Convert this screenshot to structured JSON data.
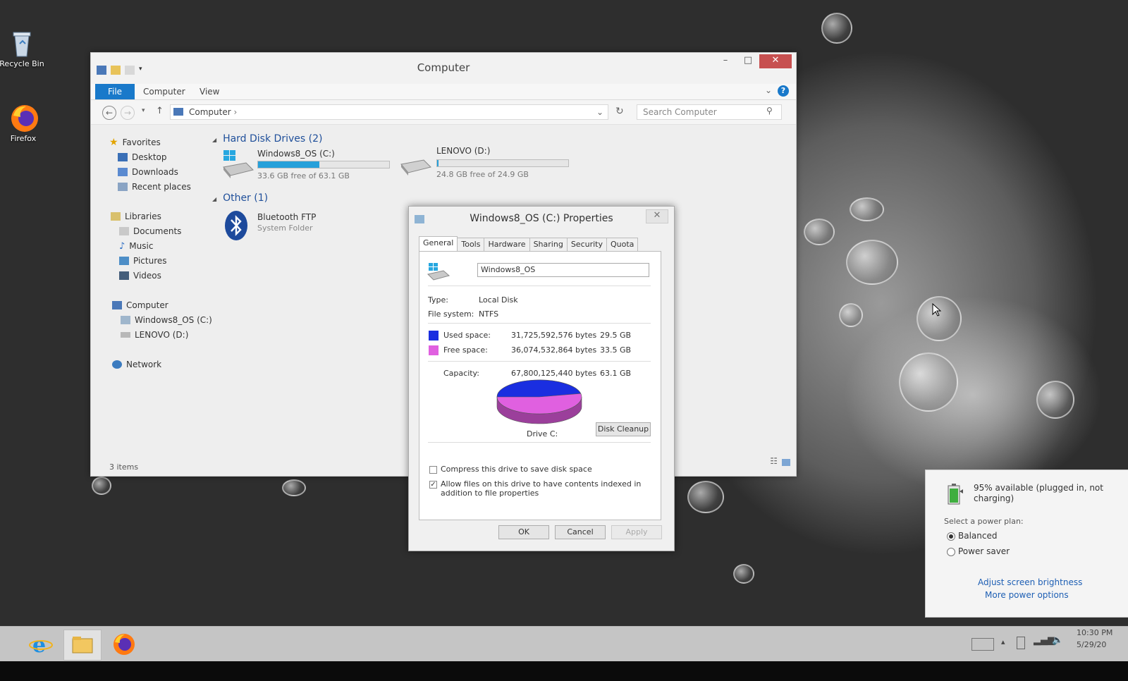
{
  "desktop": {
    "icons": [
      {
        "label": "Recycle Bin",
        "icon": "recycle-bin-icon"
      },
      {
        "label": "Firefox",
        "icon": "firefox-icon"
      }
    ]
  },
  "explorer": {
    "title": "Computer",
    "ribbon_tabs": [
      "File",
      "Computer",
      "View"
    ],
    "address": "Computer",
    "search_placeholder": "Search Computer",
    "nav": {
      "favorites": "Favorites",
      "desktop": "Desktop",
      "downloads": "Downloads",
      "recent": "Recent places",
      "libraries": "Libraries",
      "documents": "Documents",
      "music": "Music",
      "pictures": "Pictures",
      "videos": "Videos",
      "computer": "Computer",
      "drive_c": "Windows8_OS (C:)",
      "drive_d": "LENOVO (D:)",
      "network": "Network"
    },
    "groups": {
      "hdd": "Hard Disk Drives (2)",
      "other": "Other (1)"
    },
    "drives": [
      {
        "name": "Windows8_OS (C:)",
        "free": "33.6 GB free of 63.1 GB",
        "used_fraction": 0.47
      },
      {
        "name": "LENOVO (D:)",
        "free": "24.8 GB free of 24.9 GB",
        "used_fraction": 0.004
      }
    ],
    "other_item": {
      "name": "Bluetooth FTP",
      "type": "System Folder"
    },
    "status": "3 items"
  },
  "properties": {
    "title": "Windows8_OS (C:) Properties",
    "tabs": [
      "General",
      "Tools",
      "Hardware",
      "Sharing",
      "Security",
      "Quota"
    ],
    "label_value": "Windows8_OS",
    "type_label": "Type:",
    "type_value": "Local Disk",
    "fs_label": "File system:",
    "fs_value": "NTFS",
    "used_label": "Used space:",
    "used_bytes": "31,725,592,576 bytes",
    "used_gb": "29.5 GB",
    "free_label": "Free space:",
    "free_bytes": "36,074,532,864 bytes",
    "free_gb": "33.5 GB",
    "capacity_label": "Capacity:",
    "capacity_bytes": "67,800,125,440 bytes",
    "capacity_gb": "63.1 GB",
    "used_fraction": 0.468,
    "drive_label": "Drive C:",
    "cleanup_button": "Disk Cleanup",
    "compress_label": "Compress this drive to save disk space",
    "compress_checked": false,
    "index_label": "Allow files on this drive to have contents indexed in addition to file properties",
    "index_checked": true,
    "ok": "OK",
    "cancel": "Cancel",
    "apply": "Apply",
    "colors": {
      "used": "#1a2ee0",
      "free": "#e060e0"
    }
  },
  "battery": {
    "status": "95% available (plugged in, not charging)",
    "plan_prompt": "Select a power plan:",
    "plans": [
      {
        "label": "Balanced",
        "selected": true
      },
      {
        "label": "Power saver",
        "selected": false
      }
    ],
    "link_brightness": "Adjust screen brightness",
    "link_more": "More power options"
  },
  "taskbar": {
    "apps": [
      "internet-explorer-icon",
      "file-explorer-icon",
      "firefox-icon"
    ],
    "time": "10:30 PM",
    "date": "5/29/20"
  }
}
